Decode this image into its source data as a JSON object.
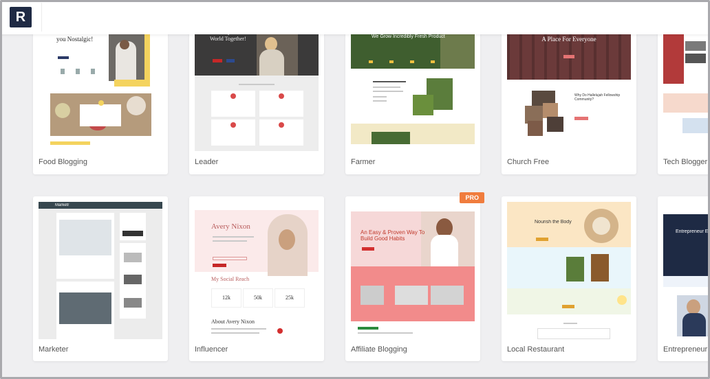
{
  "app": {
    "logo_letter": "R"
  },
  "templates": [
    {
      "name": "Food Blogging",
      "hero": "Food that makes you Nostalgic!"
    },
    {
      "name": "Leader",
      "hero": "Let's Improve the World Together!"
    },
    {
      "name": "Farmer",
      "hero": "We Grow Incredibly Fresh Product"
    },
    {
      "name": "Church Free",
      "hero": "A Place For Everyone",
      "sub": "Why Do Hallelujah Fellowship Community?"
    },
    {
      "name": "Tech Blogger"
    },
    {
      "name": "Marketer",
      "brand": "Marketr"
    },
    {
      "name": "Influencer",
      "hero": "Avery Nixon",
      "section": "My Social Reach",
      "stats": [
        "12k",
        "50k",
        "25k"
      ],
      "about": "About Avery Nixon"
    },
    {
      "name": "Affiliate Blogging",
      "badge": "PRO",
      "hero": "An Easy & Proven Way To Build Good Habits"
    },
    {
      "name": "Local Restaurant",
      "hero": "Nourish the Body"
    },
    {
      "name": "Entrepreneur",
      "hero": "Entrepreneur Evolution"
    }
  ],
  "colors": {
    "accent_pro": "#f07c3d",
    "brand_dark": "#1f2a44"
  }
}
